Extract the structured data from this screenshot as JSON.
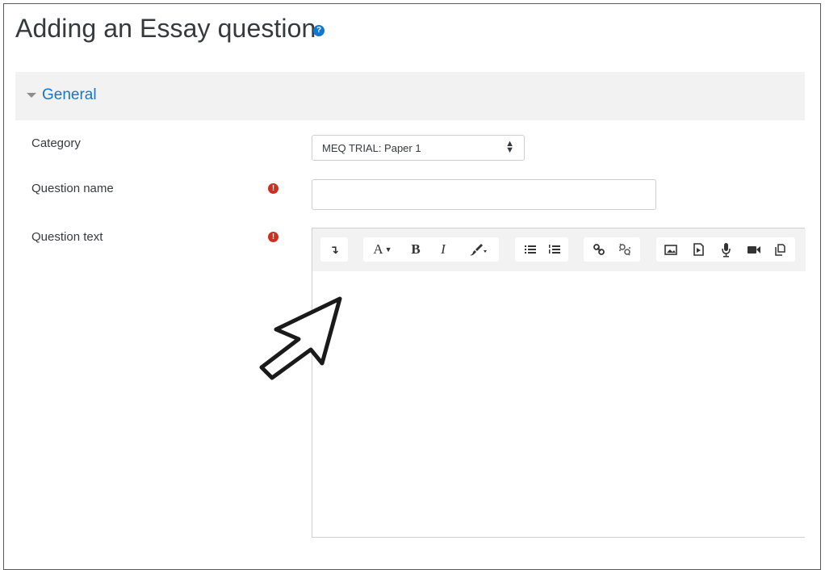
{
  "page": {
    "title": "Adding an Essay question"
  },
  "section": {
    "label": "General"
  },
  "fields": {
    "category": {
      "label": "Category",
      "value": "MEQ TRIAL: Paper 1"
    },
    "question_name": {
      "label": "Question name",
      "value": ""
    },
    "question_text": {
      "label": "Question text",
      "value": ""
    }
  },
  "toolbar": {
    "groups": [
      {
        "buttons": [
          {
            "name": "show-more-buttons",
            "icon": "arrow-down-icon",
            "glyph": "↴"
          }
        ]
      },
      {
        "buttons": [
          {
            "name": "font-style",
            "icon": "font-icon",
            "glyph": "A"
          },
          {
            "name": "bold",
            "icon": "bold-icon",
            "glyph": "B"
          },
          {
            "name": "italic",
            "icon": "italic-icon",
            "glyph": "I"
          },
          {
            "name": "text-color",
            "icon": "brush-icon",
            "glyph": "🖌"
          }
        ]
      },
      {
        "buttons": [
          {
            "name": "unordered-list",
            "icon": "unordered-list-icon"
          },
          {
            "name": "ordered-list",
            "icon": "ordered-list-icon"
          }
        ]
      },
      {
        "buttons": [
          {
            "name": "link",
            "icon": "link-icon"
          },
          {
            "name": "unlink",
            "icon": "unlink-icon"
          }
        ]
      },
      {
        "buttons": [
          {
            "name": "insert-image",
            "icon": "image-icon"
          },
          {
            "name": "insert-media",
            "icon": "media-file-icon"
          },
          {
            "name": "record-audio",
            "icon": "microphone-icon"
          },
          {
            "name": "record-video",
            "icon": "video-camera-icon"
          },
          {
            "name": "manage-files",
            "icon": "files-icon"
          }
        ]
      }
    ]
  },
  "colors": {
    "link_blue": "#1177d1",
    "required_red": "#ca3120",
    "header_bg": "#f2f2f2"
  }
}
